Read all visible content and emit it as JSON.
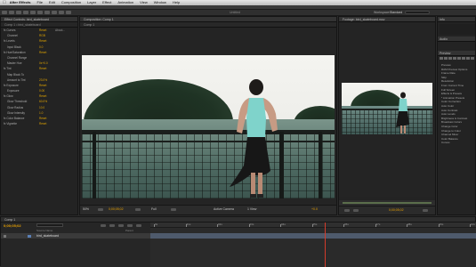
{
  "menubar": {
    "items": [
      "After Effects",
      "File",
      "Edit",
      "Composition",
      "Layer",
      "Effect",
      "Animation",
      "View",
      "Window",
      "Help"
    ]
  },
  "appbar": {
    "title": "Untitled",
    "workspace_label": "Workspace:",
    "workspace_value": "Standard"
  },
  "effect_controls": {
    "tab": "Effect Controls: bird_skateboard",
    "subtitle": "Comp 1 • bird_skateboard",
    "rows": [
      {
        "name": "fx Curves",
        "v1": "Reset",
        "v2": "About...",
        "sub": false
      },
      {
        "name": "Channel",
        "v1": "RGB",
        "v2": "",
        "sub": true
      },
      {
        "name": "fx Levels",
        "v1": "Reset",
        "v2": "",
        "sub": false
      },
      {
        "name": "Input Black",
        "v1": "0.0",
        "v2": "",
        "sub": true
      },
      {
        "name": "fx Hue/Saturation",
        "v1": "Reset",
        "v2": "",
        "sub": false
      },
      {
        "name": "Channel Range",
        "v1": "",
        "v2": "",
        "sub": true
      },
      {
        "name": "Master Hue",
        "v1": "0x+0.0",
        "v2": "",
        "sub": true
      },
      {
        "name": "fx Tint",
        "v1": "Reset",
        "v2": "",
        "sub": false
      },
      {
        "name": "Map Black To",
        "v1": "",
        "v2": "",
        "sub": true
      },
      {
        "name": "Amount to Tint",
        "v1": "23.0%",
        "v2": "",
        "sub": true
      },
      {
        "name": "fx Exposure",
        "v1": "Reset",
        "v2": "",
        "sub": false
      },
      {
        "name": "Exposure",
        "v1": "0.00",
        "v2": "",
        "sub": true
      },
      {
        "name": "fx Glow",
        "v1": "Reset",
        "v2": "",
        "sub": false
      },
      {
        "name": "Glow Threshold",
        "v1": "60.0%",
        "v2": "",
        "sub": true
      },
      {
        "name": "Glow Radius",
        "v1": "10.0",
        "v2": "",
        "sub": true
      },
      {
        "name": "Glow Intensity",
        "v1": "1.0",
        "v2": "",
        "sub": true
      },
      {
        "name": "fx Color Balance",
        "v1": "Reset",
        "v2": "",
        "sub": false
      },
      {
        "name": "fx Vignette",
        "v1": "Reset",
        "v2": "",
        "sub": false
      }
    ]
  },
  "composition": {
    "tab": "Composition: Comp 1",
    "breadcrumb": "Comp 1",
    "zoom": "50%",
    "timecode": "0;00;05;02",
    "quality": "Full",
    "camera": "Active Camera",
    "views": "1 View",
    "exposure": "+0.0"
  },
  "footage": {
    "tab": "Footage: bird_skateboard.mov",
    "timecode": "0;00;05;02"
  },
  "right_panels": {
    "info_tab": "Info",
    "audio_tab": "Audio",
    "preview_tab": "Preview",
    "effects_tab": "Effects & Presets",
    "rows": [
      "Preview",
      "RAM Preview Options",
      "Frame Rate",
      "Skip",
      "Resolution",
      "From Current Time",
      "Full Screen",
      "Effects & Presets",
      "* Animation Presets",
      "Color Correction",
      "Auto Color",
      "Auto Contrast",
      "Auto Levels",
      "Brightness & Contrast",
      "Broadcast Colors",
      "Change Color",
      "Change to Color",
      "Channel Mixer",
      "Color Balance",
      "Curves"
    ]
  },
  "timeline": {
    "tab": "Comp 1",
    "timecode": "0;00;05;02",
    "layer_name": "bird_skateboard",
    "source_col": "Source Name",
    "parent_col": "Parent",
    "ruler": [
      "0s",
      "01s",
      "02s",
      "03s",
      "04s",
      "05s",
      "06s",
      "07s",
      "08s",
      "09s",
      "10s"
    ],
    "playhead_fraction": 0.54
  }
}
